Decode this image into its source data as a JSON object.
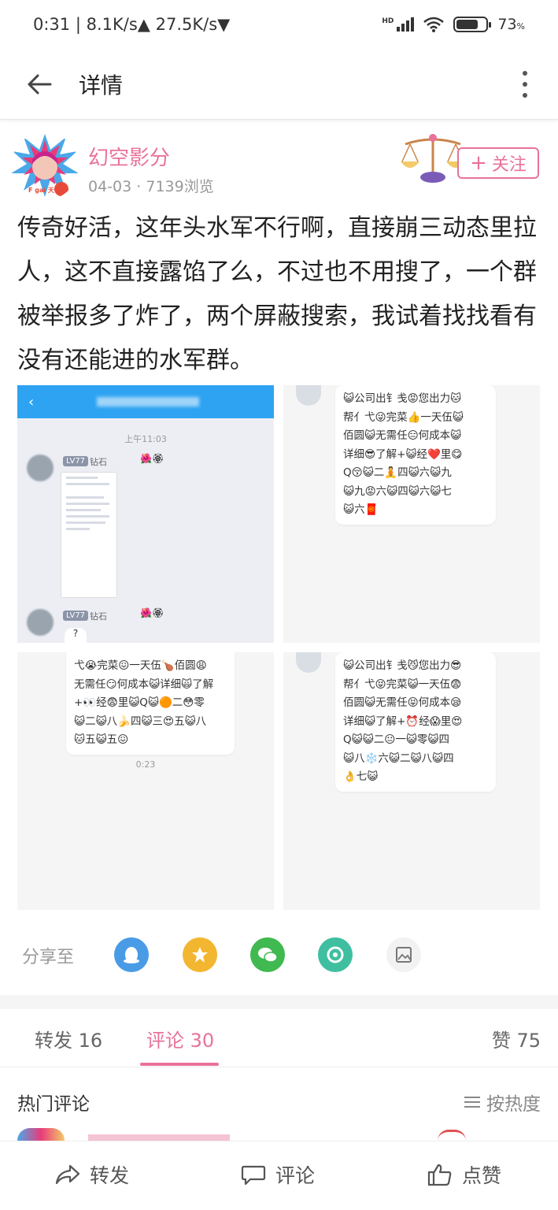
{
  "status_bar": {
    "time": "0:31",
    "network": "8.1K/s▲ 27.5K/s▼",
    "hd_label": "HD",
    "battery": "73",
    "battery_level": 0.73
  },
  "header": {
    "title": "详情"
  },
  "post": {
    "author_name": "幻空影分",
    "date": "04-03",
    "views": "7139浏览",
    "follow_label": "关注",
    "text": "传奇好活，这年头水军不行啊，直接崩三动态里拉人，这不直接露馅了么，不过也不用搜了，一个群被举报多了炸了，两个屏蔽搜索，我试着找找看有没有还能进的水军群。",
    "avatar_tag": "F gai 天"
  },
  "images": {
    "img1": {
      "chat_time": "上午11:03",
      "level_tag": "LV77",
      "rank": "钻石",
      "qmark": "?"
    },
    "img2": {
      "lines": [
        "😺公司出钅戋😡您出力🐱",
        "帮亻弋😜完菜👍一天伍😺",
        "佰圆😺无需任😑何成本😺",
        "详细😎了解+😺经❤️里😋",
        "Q😚😺二🧘四😺六😺九",
        "😺九😡六😺四😺六😺七",
        "😺六🧧"
      ]
    },
    "img3": {
      "lines": [
        "弋😭完菜😖一天伍🍗佰圆😩",
        "无需任😏何成本😺详细🙀了解",
        "+👀经😨里😺Q😺🟠二😳零",
        "😺二😺八🍌四😺三😍五😺八",
        "🐱五😺五😖"
      ],
      "time": "0:23"
    },
    "img4": {
      "lines": [
        "😺公司出钅戋😼您出力😎",
        "帮亻弋😝完菜😺一天伍😨",
        "佰圆😺无需任😝何成本😪",
        "详细😺了解+⏰经😱里😍",
        "Q😺😺二😐一😺零😺四",
        "😺八❄️六😺二😺八😺四",
        "👌七😺"
      ]
    }
  },
  "share": {
    "label": "分享至",
    "icons": [
      "qq-icon",
      "qzone-icon",
      "wechat-icon",
      "moments-icon",
      "save-image-icon"
    ]
  },
  "tabs": {
    "repost": "转发 16",
    "comment": "评论 30",
    "like": "赞 75"
  },
  "comments": {
    "hot_title": "热门评论",
    "sort_label": "按热度"
  },
  "bottom_bar": {
    "repost": "转发",
    "comment": "评论",
    "like": "点赞"
  },
  "colors": {
    "accent": "#e8729a",
    "qq": "#4a9be6",
    "qzone": "#f3b630",
    "wechat": "#3fb950",
    "moments": "#3fbfa0"
  }
}
